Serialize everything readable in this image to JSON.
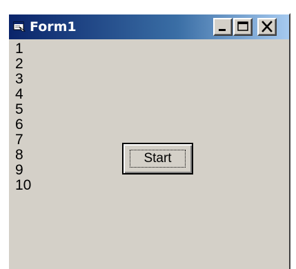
{
  "window": {
    "title": "Form1",
    "title_icon": "form-icon",
    "caption_buttons": {
      "minimize_icon": "minimize-icon",
      "maximize_icon": "maximize-icon",
      "close_icon": "close-icon"
    }
  },
  "form": {
    "numbers": [
      "1",
      "2",
      "3",
      "4",
      "5",
      "6",
      "7",
      "8",
      "9",
      "10"
    ],
    "start_button_label": "Start"
  },
  "colors": {
    "title_gradient_start": "#0a246a",
    "title_gradient_end": "#a6caf0",
    "face": "#d4d0c8"
  }
}
